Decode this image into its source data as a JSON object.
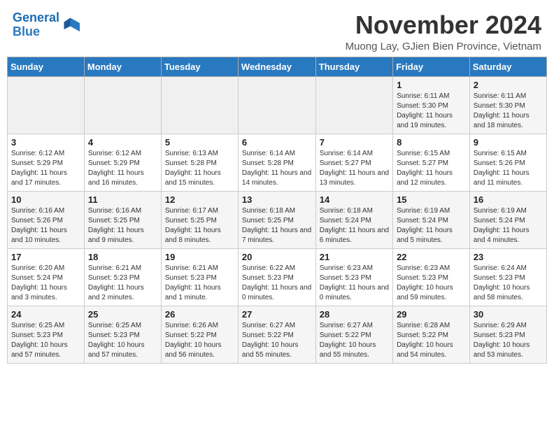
{
  "header": {
    "logo_line1": "General",
    "logo_line2": "Blue",
    "month_title": "November 2024",
    "subtitle": "Muong Lay, GJien Bien Province, Vietnam"
  },
  "weekdays": [
    "Sunday",
    "Monday",
    "Tuesday",
    "Wednesday",
    "Thursday",
    "Friday",
    "Saturday"
  ],
  "weeks": [
    [
      {
        "day": "",
        "info": ""
      },
      {
        "day": "",
        "info": ""
      },
      {
        "day": "",
        "info": ""
      },
      {
        "day": "",
        "info": ""
      },
      {
        "day": "",
        "info": ""
      },
      {
        "day": "1",
        "info": "Sunrise: 6:11 AM\nSunset: 5:30 PM\nDaylight: 11 hours and 19 minutes."
      },
      {
        "day": "2",
        "info": "Sunrise: 6:11 AM\nSunset: 5:30 PM\nDaylight: 11 hours and 18 minutes."
      }
    ],
    [
      {
        "day": "3",
        "info": "Sunrise: 6:12 AM\nSunset: 5:29 PM\nDaylight: 11 hours and 17 minutes."
      },
      {
        "day": "4",
        "info": "Sunrise: 6:12 AM\nSunset: 5:29 PM\nDaylight: 11 hours and 16 minutes."
      },
      {
        "day": "5",
        "info": "Sunrise: 6:13 AM\nSunset: 5:28 PM\nDaylight: 11 hours and 15 minutes."
      },
      {
        "day": "6",
        "info": "Sunrise: 6:14 AM\nSunset: 5:28 PM\nDaylight: 11 hours and 14 minutes."
      },
      {
        "day": "7",
        "info": "Sunrise: 6:14 AM\nSunset: 5:27 PM\nDaylight: 11 hours and 13 minutes."
      },
      {
        "day": "8",
        "info": "Sunrise: 6:15 AM\nSunset: 5:27 PM\nDaylight: 11 hours and 12 minutes."
      },
      {
        "day": "9",
        "info": "Sunrise: 6:15 AM\nSunset: 5:26 PM\nDaylight: 11 hours and 11 minutes."
      }
    ],
    [
      {
        "day": "10",
        "info": "Sunrise: 6:16 AM\nSunset: 5:26 PM\nDaylight: 11 hours and 10 minutes."
      },
      {
        "day": "11",
        "info": "Sunrise: 6:16 AM\nSunset: 5:25 PM\nDaylight: 11 hours and 9 minutes."
      },
      {
        "day": "12",
        "info": "Sunrise: 6:17 AM\nSunset: 5:25 PM\nDaylight: 11 hours and 8 minutes."
      },
      {
        "day": "13",
        "info": "Sunrise: 6:18 AM\nSunset: 5:25 PM\nDaylight: 11 hours and 7 minutes."
      },
      {
        "day": "14",
        "info": "Sunrise: 6:18 AM\nSunset: 5:24 PM\nDaylight: 11 hours and 6 minutes."
      },
      {
        "day": "15",
        "info": "Sunrise: 6:19 AM\nSunset: 5:24 PM\nDaylight: 11 hours and 5 minutes."
      },
      {
        "day": "16",
        "info": "Sunrise: 6:19 AM\nSunset: 5:24 PM\nDaylight: 11 hours and 4 minutes."
      }
    ],
    [
      {
        "day": "17",
        "info": "Sunrise: 6:20 AM\nSunset: 5:24 PM\nDaylight: 11 hours and 3 minutes."
      },
      {
        "day": "18",
        "info": "Sunrise: 6:21 AM\nSunset: 5:23 PM\nDaylight: 11 hours and 2 minutes."
      },
      {
        "day": "19",
        "info": "Sunrise: 6:21 AM\nSunset: 5:23 PM\nDaylight: 11 hours and 1 minute."
      },
      {
        "day": "20",
        "info": "Sunrise: 6:22 AM\nSunset: 5:23 PM\nDaylight: 11 hours and 0 minutes."
      },
      {
        "day": "21",
        "info": "Sunrise: 6:23 AM\nSunset: 5:23 PM\nDaylight: 11 hours and 0 minutes."
      },
      {
        "day": "22",
        "info": "Sunrise: 6:23 AM\nSunset: 5:23 PM\nDaylight: 10 hours and 59 minutes."
      },
      {
        "day": "23",
        "info": "Sunrise: 6:24 AM\nSunset: 5:23 PM\nDaylight: 10 hours and 58 minutes."
      }
    ],
    [
      {
        "day": "24",
        "info": "Sunrise: 6:25 AM\nSunset: 5:23 PM\nDaylight: 10 hours and 57 minutes."
      },
      {
        "day": "25",
        "info": "Sunrise: 6:25 AM\nSunset: 5:23 PM\nDaylight: 10 hours and 57 minutes."
      },
      {
        "day": "26",
        "info": "Sunrise: 6:26 AM\nSunset: 5:22 PM\nDaylight: 10 hours and 56 minutes."
      },
      {
        "day": "27",
        "info": "Sunrise: 6:27 AM\nSunset: 5:22 PM\nDaylight: 10 hours and 55 minutes."
      },
      {
        "day": "28",
        "info": "Sunrise: 6:27 AM\nSunset: 5:22 PM\nDaylight: 10 hours and 55 minutes."
      },
      {
        "day": "29",
        "info": "Sunrise: 6:28 AM\nSunset: 5:22 PM\nDaylight: 10 hours and 54 minutes."
      },
      {
        "day": "30",
        "info": "Sunrise: 6:29 AM\nSunset: 5:23 PM\nDaylight: 10 hours and 53 minutes."
      }
    ]
  ]
}
